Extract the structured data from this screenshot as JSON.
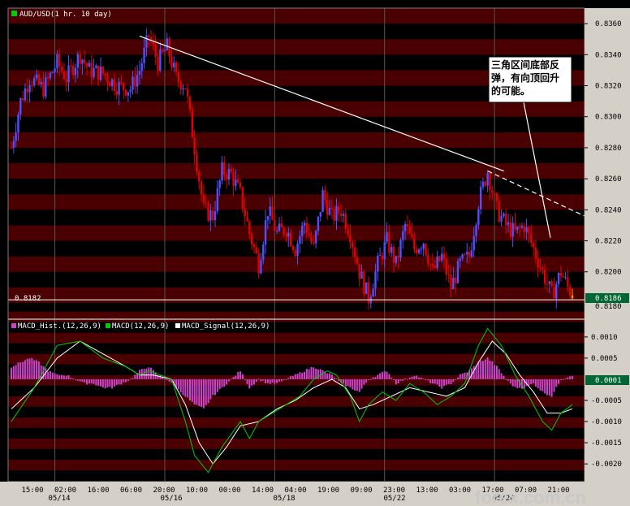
{
  "main_panel": {
    "legend_text": "AUD/USD(1 hr.  10 day)",
    "legend_color": "#00cc00",
    "last_price_label": "0.8186",
    "baseline_label": "0.8182",
    "axis_label_0_8180": "0.8180",
    "annotation_line1": "三角区间底部反",
    "annotation_line2": "弹，有向顶回升",
    "annotation_line3": "的可能。"
  },
  "indicator_panel": {
    "legend": [
      {
        "text": "MACD_Hist.(12,26,9)",
        "color": "#cc44cc"
      },
      {
        "text": "MACD(12,26,9)",
        "color": "#00cc00"
      },
      {
        "text": "MACD_Signal(12,26,9)",
        "color": "#ffffff"
      }
    ],
    "last_hist_label": "0.0001"
  },
  "time_labels": [
    "15:00",
    "02:00",
    "16:00",
    "06:00",
    "20:00",
    "10:00",
    "00:00",
    "14:00",
    "04:00",
    "19:00",
    "09:00",
    "23:00",
    "13:00",
    "03:00",
    "17:00",
    "07:00",
    "21:00"
  ],
  "date_labels": [
    "05/14",
    "05/16",
    "05/18",
    "05/22",
    "05/24"
  ],
  "watermark": "forex.com.cn",
  "colors": {
    "up": "#5050ff",
    "down": "#e00000",
    "band_dark": "#000000",
    "band_red": "#4a0000",
    "macd": "#00cc00",
    "signal": "#ffffff",
    "hist": "#cc44cc",
    "price_tag": "#006633"
  },
  "chart_data": [
    {
      "type": "candlestick",
      "title": "AUD/USD(1 hr.  10 day)",
      "ylim": [
        0.817,
        0.837
      ],
      "yticks": [
        0.836,
        0.834,
        0.832,
        0.83,
        0.828,
        0.826,
        0.824,
        0.822,
        0.82,
        0.818
      ],
      "close_path": [
        [
          0,
          0.828
        ],
        [
          4,
          0.831
        ],
        [
          8,
          0.8325
        ],
        [
          14,
          0.8318
        ],
        [
          20,
          0.8335
        ],
        [
          24,
          0.8325
        ],
        [
          30,
          0.834
        ],
        [
          34,
          0.833
        ],
        [
          40,
          0.8328
        ],
        [
          46,
          0.832
        ],
        [
          52,
          0.8318
        ],
        [
          56,
          0.833
        ],
        [
          60,
          0.8352
        ],
        [
          64,
          0.8335
        ],
        [
          68,
          0.8345
        ],
        [
          72,
          0.8325
        ],
        [
          76,
          0.832
        ],
        [
          80,
          0.828
        ],
        [
          84,
          0.824
        ],
        [
          88,
          0.8236
        ],
        [
          92,
          0.8265
        ],
        [
          96,
          0.8263
        ],
        [
          100,
          0.825
        ],
        [
          104,
          0.8225
        ],
        [
          108,
          0.8205
        ],
        [
          112,
          0.824
        ],
        [
          116,
          0.8225
        ],
        [
          120,
          0.8228
        ],
        [
          124,
          0.8215
        ],
        [
          128,
          0.8232
        ],
        [
          132,
          0.8215
        ],
        [
          136,
          0.825
        ],
        [
          140,
          0.8235
        ],
        [
          144,
          0.824
        ],
        [
          148,
          0.8225
        ],
        [
          152,
          0.82
        ],
        [
          156,
          0.8183
        ],
        [
          160,
          0.8205
        ],
        [
          164,
          0.822
        ],
        [
          168,
          0.8205
        ],
        [
          172,
          0.823
        ],
        [
          176,
          0.8215
        ],
        [
          180,
          0.822
        ],
        [
          184,
          0.82
        ],
        [
          188,
          0.821
        ],
        [
          192,
          0.819
        ],
        [
          196,
          0.8205
        ],
        [
          200,
          0.821
        ],
        [
          204,
          0.8245
        ],
        [
          208,
          0.8265
        ],
        [
          212,
          0.824
        ],
        [
          216,
          0.823
        ],
        [
          220,
          0.8225
        ],
        [
          224,
          0.823
        ],
        [
          228,
          0.8215
        ],
        [
          232,
          0.82
        ],
        [
          236,
          0.8185
        ],
        [
          240,
          0.82
        ],
        [
          243,
          0.819
        ],
        [
          245,
          0.8186
        ]
      ],
      "last_price": 0.8186,
      "annotations": [
        {
          "type": "trendline",
          "from": [
            56,
            0.8352
          ],
          "to": [
            208,
            0.8265
          ],
          "style": "solid"
        },
        {
          "type": "trendline",
          "from": [
            208,
            0.8265
          ],
          "to": [
            245,
            0.8236
          ],
          "style": "dashed"
        },
        {
          "type": "horizontal_line",
          "y": 0.8182
        },
        {
          "type": "arrow_line",
          "from": [
            220,
            0.8315
          ],
          "to": [
            230,
            0.8222
          ]
        }
      ]
    },
    {
      "type": "macd",
      "ylim": [
        -0.0024,
        0.0014
      ],
      "yticks": [
        0.001,
        0.0005,
        0.0001,
        -0.0005,
        -0.001,
        -0.0015,
        -0.002
      ],
      "macd_line": [
        [
          0,
          -0.001
        ],
        [
          10,
          -0.0002
        ],
        [
          20,
          0.0008
        ],
        [
          30,
          0.0009
        ],
        [
          40,
          0.0005
        ],
        [
          50,
          0.0003
        ],
        [
          56,
          0.0001
        ],
        [
          60,
          0.0002
        ],
        [
          70,
          0.0
        ],
        [
          76,
          -0.001
        ],
        [
          80,
          -0.0018
        ],
        [
          86,
          -0.0022
        ],
        [
          92,
          -0.0016
        ],
        [
          100,
          -0.001
        ],
        [
          104,
          -0.0014
        ],
        [
          108,
          -0.001
        ],
        [
          114,
          -0.0008
        ],
        [
          120,
          -0.0006
        ],
        [
          126,
          -0.0004
        ],
        [
          132,
          0.0
        ],
        [
          138,
          0.0002
        ],
        [
          142,
          0.0001
        ],
        [
          148,
          -0.0004
        ],
        [
          152,
          -0.001
        ],
        [
          156,
          -0.0006
        ],
        [
          162,
          -0.0003
        ],
        [
          168,
          -0.0005
        ],
        [
          174,
          -0.0001
        ],
        [
          180,
          -0.0003
        ],
        [
          186,
          -0.0006
        ],
        [
          192,
          -0.0004
        ],
        [
          198,
          -0.0001
        ],
        [
          204,
          0.0008
        ],
        [
          208,
          0.0012
        ],
        [
          214,
          0.0008
        ],
        [
          220,
          0.0001
        ],
        [
          226,
          -0.0004
        ],
        [
          232,
          -0.001
        ],
        [
          236,
          -0.0012
        ],
        [
          240,
          -0.0008
        ],
        [
          245,
          -0.0006
        ]
      ],
      "signal_line": [
        [
          0,
          -0.0007
        ],
        [
          10,
          -0.0002
        ],
        [
          20,
          0.0005
        ],
        [
          30,
          0.0009
        ],
        [
          40,
          0.0006
        ],
        [
          50,
          0.0003
        ],
        [
          56,
          0.0001
        ],
        [
          62,
          0.0001
        ],
        [
          70,
          0.0
        ],
        [
          76,
          -0.0006
        ],
        [
          82,
          -0.0015
        ],
        [
          88,
          -0.002
        ],
        [
          94,
          -0.0016
        ],
        [
          100,
          -0.0011
        ],
        [
          108,
          -0.001
        ],
        [
          116,
          -0.0007
        ],
        [
          124,
          -0.0005
        ],
        [
          132,
          -0.0002
        ],
        [
          140,
          0.0
        ],
        [
          146,
          -0.0002
        ],
        [
          152,
          -0.0007
        ],
        [
          158,
          -0.0006
        ],
        [
          166,
          -0.0004
        ],
        [
          174,
          -0.0002
        ],
        [
          182,
          -0.0003
        ],
        [
          190,
          -0.0004
        ],
        [
          198,
          -0.0002
        ],
        [
          204,
          0.0004
        ],
        [
          210,
          0.0009
        ],
        [
          216,
          0.0006
        ],
        [
          222,
          0.0001
        ],
        [
          228,
          -0.0003
        ],
        [
          234,
          -0.0008
        ],
        [
          240,
          -0.0008
        ],
        [
          245,
          -0.0007
        ]
      ],
      "histogram": [
        [
          0,
          0.0003
        ],
        [
          4,
          0.0004
        ],
        [
          8,
          0.0005
        ],
        [
          12,
          0.0004
        ],
        [
          16,
          0.0002
        ],
        [
          20,
          0.0001
        ],
        [
          24,
          0.0001
        ],
        [
          28,
          0.0
        ],
        [
          32,
          -0.0001
        ],
        [
          36,
          -0.0001
        ],
        [
          40,
          -0.0002
        ],
        [
          44,
          -0.0002
        ],
        [
          48,
          -0.0001
        ],
        [
          52,
          0.0
        ],
        [
          56,
          0.0002
        ],
        [
          60,
          0.0003
        ],
        [
          64,
          0.0001
        ],
        [
          68,
          0.0
        ],
        [
          72,
          -0.0002
        ],
        [
          76,
          -0.0004
        ],
        [
          80,
          -0.0006
        ],
        [
          84,
          -0.0007
        ],
        [
          88,
          -0.0004
        ],
        [
          92,
          -0.0002
        ],
        [
          96,
          0.0
        ],
        [
          100,
          0.0002
        ],
        [
          104,
          -0.0002
        ],
        [
          108,
          0.0
        ],
        [
          112,
          -0.0001
        ],
        [
          116,
          -0.0001
        ],
        [
          120,
          0.0
        ],
        [
          124,
          0.0001
        ],
        [
          128,
          0.0002
        ],
        [
          132,
          0.0003
        ],
        [
          136,
          0.0002
        ],
        [
          140,
          0.0001
        ],
        [
          144,
          -0.0001
        ],
        [
          148,
          -0.0002
        ],
        [
          152,
          -0.0003
        ],
        [
          156,
          0.0
        ],
        [
          160,
          0.0001
        ],
        [
          164,
          0.0002
        ],
        [
          168,
          -0.0001
        ],
        [
          172,
          0.0
        ],
        [
          176,
          0.0001
        ],
        [
          180,
          0.0
        ],
        [
          184,
          -0.0001
        ],
        [
          188,
          -0.0002
        ],
        [
          192,
          -0.0001
        ],
        [
          196,
          0.0001
        ],
        [
          200,
          0.0002
        ],
        [
          204,
          0.0004
        ],
        [
          208,
          0.0005
        ],
        [
          212,
          0.0003
        ],
        [
          216,
          0.0
        ],
        [
          220,
          -0.0002
        ],
        [
          224,
          -0.0002
        ],
        [
          228,
          -0.0001
        ],
        [
          232,
          -0.0003
        ],
        [
          236,
          -0.0004
        ],
        [
          240,
          0.0
        ],
        [
          245,
          0.0001
        ]
      ],
      "last_value": 0.0001
    }
  ]
}
